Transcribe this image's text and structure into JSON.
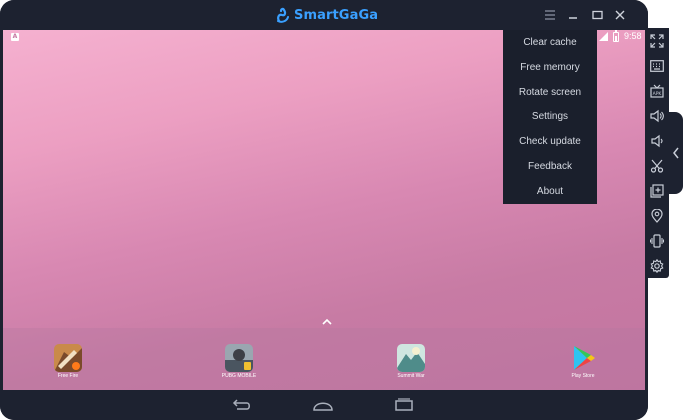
{
  "app": {
    "brand_name": "SmartGaGa",
    "brand_color": "#3aa0ff",
    "icons": {
      "logo": "swan-logo-icon",
      "menu": "hamburger-menu-icon",
      "minimize": "minimize-icon",
      "maximize": "maximize-icon",
      "close": "close-icon"
    }
  },
  "status_bar": {
    "time": "9:58",
    "icons": [
      "notification-icon",
      "signal-icon",
      "battery-icon"
    ]
  },
  "menu": {
    "items": [
      {
        "label": "Clear cache"
      },
      {
        "label": "Free memory"
      },
      {
        "label": "Rotate screen"
      },
      {
        "label": "Settings"
      },
      {
        "label": "Check update"
      },
      {
        "label": "Feedback"
      },
      {
        "label": "About"
      }
    ]
  },
  "dock": {
    "apps": [
      {
        "label": "Free Fire",
        "icon": "free-fire-app-icon"
      },
      {
        "label": "PUBG MOBILE",
        "icon": "pubg-mobile-app-icon"
      },
      {
        "label": "Summit War",
        "icon": "summit-war-app-icon"
      },
      {
        "label": "Play Store",
        "icon": "play-store-app-icon"
      }
    ]
  },
  "sidebar": {
    "tools": [
      "fullscreen-icon",
      "keyboard-icon",
      "apk-install-icon",
      "volume-up-icon",
      "volume-down-icon",
      "screenshot-icon",
      "multi-instance-icon",
      "location-icon",
      "shake-icon",
      "settings-gear-icon"
    ],
    "collapse_icon": "chevron-left-icon"
  },
  "nav_bar": {
    "icons": [
      "back-icon",
      "home-icon",
      "recent-apps-icon"
    ]
  },
  "colors": {
    "chrome": "#1d2230",
    "menu_bg": "#1a1f2c",
    "wallpaper_top": "#f5b1d0",
    "wallpaper_bottom": "#c374a0"
  }
}
